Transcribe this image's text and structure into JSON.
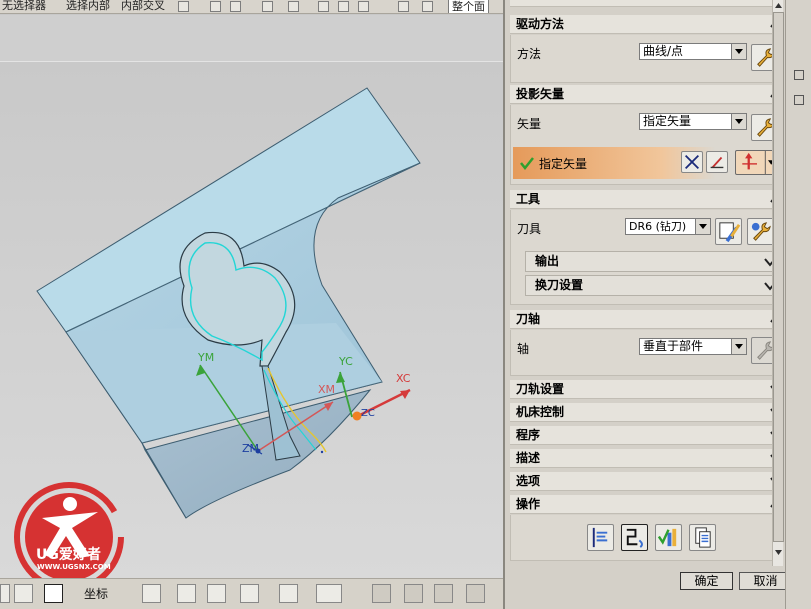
{
  "toolbar_top": {
    "items": [
      "无选择器",
      "选择内部",
      "内部交叉"
    ],
    "right_label": "整个面"
  },
  "viewport": {
    "axis_labels": {
      "ym": "YM",
      "yc": "YC",
      "xm": "XM",
      "xc": "XC",
      "zm": "ZM",
      "zc": "ZC"
    },
    "logo": {
      "name": "UG爱好者",
      "url": "WWW.UGSNX.COM"
    }
  },
  "toolbar_bottom": {
    "label": "坐标"
  },
  "panel": {
    "sections": [
      {
        "id": "drive",
        "title": "驱动方法",
        "expanded": true,
        "field_label": "方法",
        "combo_value": "曲线/点"
      },
      {
        "id": "projection",
        "title": "投影矢量",
        "expanded": true,
        "field_label": "矢量",
        "combo_value": "指定矢量",
        "highlight_label": "指定矢量"
      },
      {
        "id": "tool",
        "title": "工具",
        "expanded": true,
        "field_label": "刀具",
        "combo_value": "DR6 (钻刀)",
        "sub_rows": [
          "输出",
          "换刀设置"
        ]
      },
      {
        "id": "axis",
        "title": "刀轴",
        "expanded": true,
        "field_label": "轴",
        "combo_value": "垂直于部件"
      },
      {
        "id": "path",
        "title": "刀轨设置",
        "expanded": false
      },
      {
        "id": "machine",
        "title": "机床控制",
        "expanded": false
      },
      {
        "id": "program",
        "title": "程序",
        "expanded": false
      },
      {
        "id": "describe",
        "title": "描述",
        "expanded": false
      },
      {
        "id": "options",
        "title": "选项",
        "expanded": false
      },
      {
        "id": "operation",
        "title": "操作",
        "expanded": true
      }
    ],
    "ok_label": "确定",
    "cancel_label": "取消"
  },
  "colors": {
    "panel_bg": "#d4d0c8",
    "highlight_start": "#e9a46a",
    "part_face": "#a9cde0",
    "accent_red": "#e03030"
  }
}
